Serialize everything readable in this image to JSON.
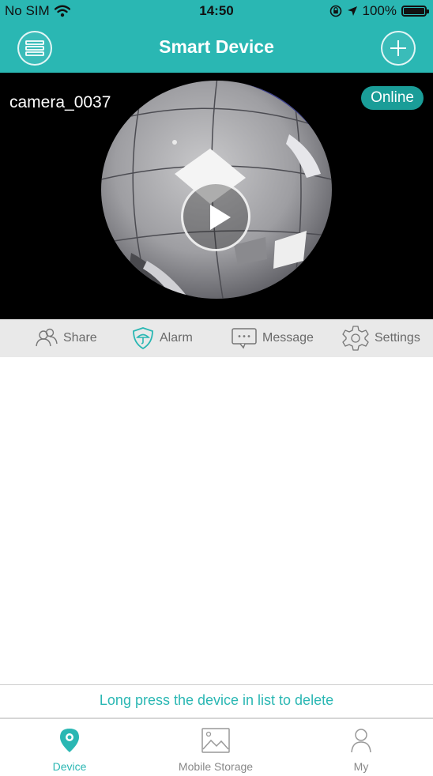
{
  "status_bar": {
    "carrier": "No SIM",
    "time": "14:50",
    "battery": "100%"
  },
  "nav": {
    "title": "Smart Device"
  },
  "device": {
    "name": "camera_0037",
    "status": "Online"
  },
  "actions": [
    {
      "label": "Share",
      "icon": "share-users-icon"
    },
    {
      "label": "Alarm",
      "icon": "alarm-shield-icon"
    },
    {
      "label": "Message",
      "icon": "message-icon"
    },
    {
      "label": "Settings",
      "icon": "gear-icon"
    }
  ],
  "hint": "Long press the device in list to delete",
  "tabs": [
    {
      "label": "Device",
      "icon": "location-pin-icon",
      "active": true
    },
    {
      "label": "Mobile Storage",
      "icon": "image-icon",
      "active": false
    },
    {
      "label": "My",
      "icon": "user-icon",
      "active": false
    }
  ],
  "colors": {
    "accent": "#2ab7b3",
    "online_badge": "#1a9d98",
    "action_bar": "#e9e9e9"
  }
}
